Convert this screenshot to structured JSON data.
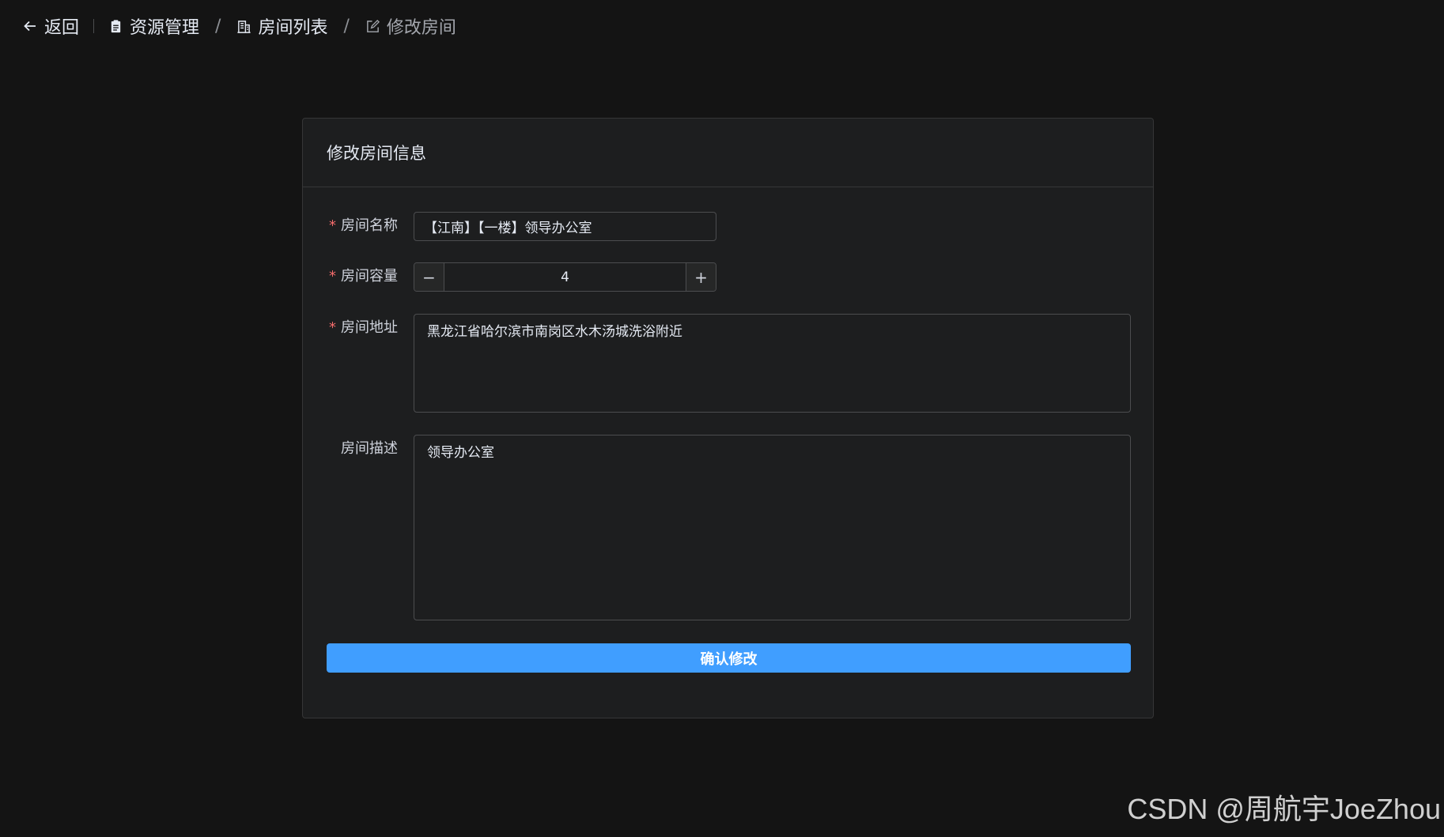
{
  "header": {
    "back_label": "返回",
    "breadcrumb": [
      {
        "label": "资源管理",
        "icon": "clipboard-icon"
      },
      {
        "label": "房间列表",
        "icon": "building-icon"
      },
      {
        "label": "修改房间",
        "icon": "edit-icon"
      }
    ],
    "separator": "/"
  },
  "card": {
    "title": "修改房间信息"
  },
  "form": {
    "name": {
      "label": "房间名称",
      "required": true,
      "value": "【江南】【一楼】领导办公室"
    },
    "capacity": {
      "label": "房间容量",
      "required": true,
      "value": "4",
      "decrement": "−",
      "increment": "+"
    },
    "address": {
      "label": "房间地址",
      "required": true,
      "value": "黑龙江省哈尔滨市南岗区水木汤城洗浴附近"
    },
    "description": {
      "label": "房间描述",
      "required": false,
      "value": "领导办公室"
    },
    "required_mark": "*",
    "submit_label": "确认修改"
  },
  "watermark": "CSDN @周航宇JoeZhou",
  "colors": {
    "primary": "#409eff",
    "required": "#f56c6c",
    "background": "#141414",
    "card": "#1d1e1f"
  }
}
